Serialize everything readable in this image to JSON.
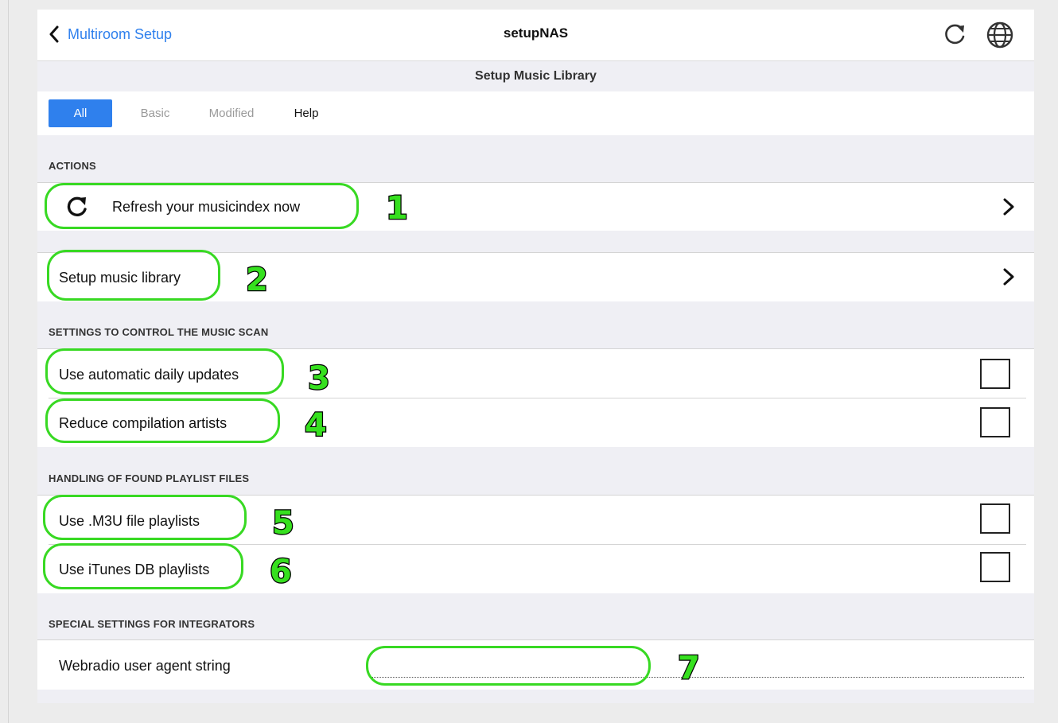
{
  "header": {
    "back_label": "Multiroom Setup",
    "title": "setupNAS",
    "refresh_icon": "refresh-icon",
    "globe_icon": "globe-icon"
  },
  "subtitle": "Setup Music Library",
  "tabs": [
    {
      "label": "All",
      "state": "active"
    },
    {
      "label": "Basic",
      "state": "disabled"
    },
    {
      "label": "Modified",
      "state": "disabled"
    },
    {
      "label": "Help",
      "state": "normal"
    }
  ],
  "sections": {
    "actions": "ACTIONS",
    "scan": "SETTINGS TO CONTROL THE MUSIC SCAN",
    "playlists": "HANDLING OF FOUND PLAYLIST FILES",
    "integrators": "SPECIAL SETTINGS FOR INTEGRATORS"
  },
  "items": {
    "refresh_index": "Refresh your musicindex now",
    "setup_library": "Setup music library",
    "auto_updates": {
      "label": "Use automatic daily updates",
      "checked": false
    },
    "reduce_artists": {
      "label": "Reduce compilation artists",
      "checked": false
    },
    "m3u_playlists": {
      "label": "Use .M3U file playlists",
      "checked": false
    },
    "itunes_playlists": {
      "label": "Use iTunes DB playlists",
      "checked": false
    },
    "user_agent": {
      "label": "Webradio user agent string",
      "value": ""
    }
  },
  "annotations": [
    "1",
    "2",
    "3",
    "4",
    "5",
    "6",
    "7"
  ],
  "colors": {
    "accent": "#2f80ed",
    "annotation_green": "#38d923",
    "background": "#efeff4"
  }
}
